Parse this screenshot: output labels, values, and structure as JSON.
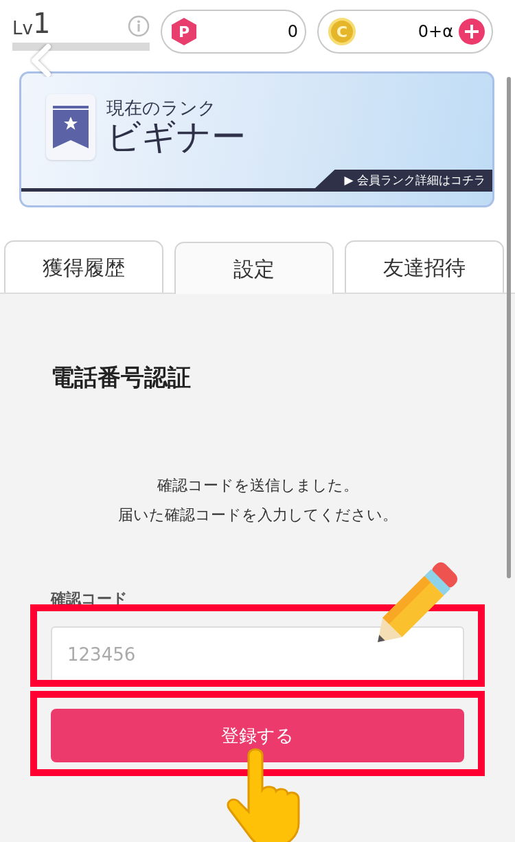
{
  "header": {
    "level_label": "Lv",
    "level_number": "1",
    "points_mark": "P",
    "points": "0",
    "coins_mark": "C",
    "coins": "0+α"
  },
  "rank_banner": {
    "caption": "現在のランク",
    "rank": "ビギナー",
    "detail_link": "▶ 会員ランク詳細はコチラ"
  },
  "tabs": [
    {
      "label": "獲得履歴",
      "selected": false
    },
    {
      "label": "設定",
      "selected": true
    },
    {
      "label": "友達招待",
      "selected": false
    }
  ],
  "section": {
    "title": "電話番号認証",
    "message_lines": [
      "確認コードを送信しました。",
      "届いた確認コードを入力してください。"
    ],
    "field": {
      "label": "確認コード",
      "placeholder": "123456"
    },
    "submit": "登録する"
  }
}
